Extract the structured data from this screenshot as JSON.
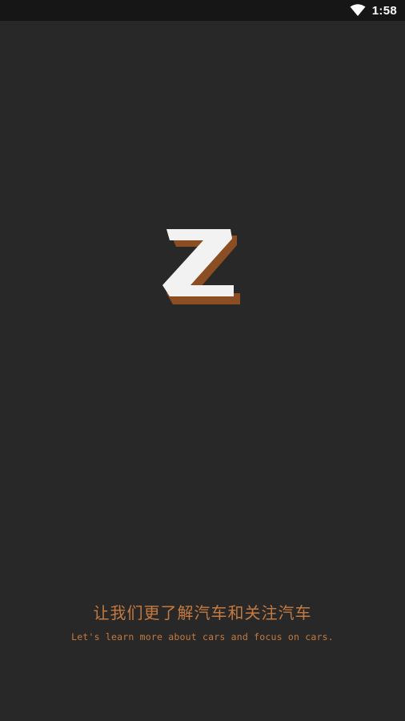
{
  "status_bar": {
    "time": "1:58",
    "wifi_icon": "wifi-icon"
  },
  "splash": {
    "logo_icon": "z-logo-icon",
    "tagline_cn": "让我们更了解汽车和关注汽车",
    "tagline_en": "Let's learn more about cars and focus on cars."
  },
  "colors": {
    "background": "#282828",
    "status_bar": "#161616",
    "accent": "#c47a40",
    "logo_fill": "#f2f2f2",
    "logo_shadow": "#8a4e22"
  }
}
